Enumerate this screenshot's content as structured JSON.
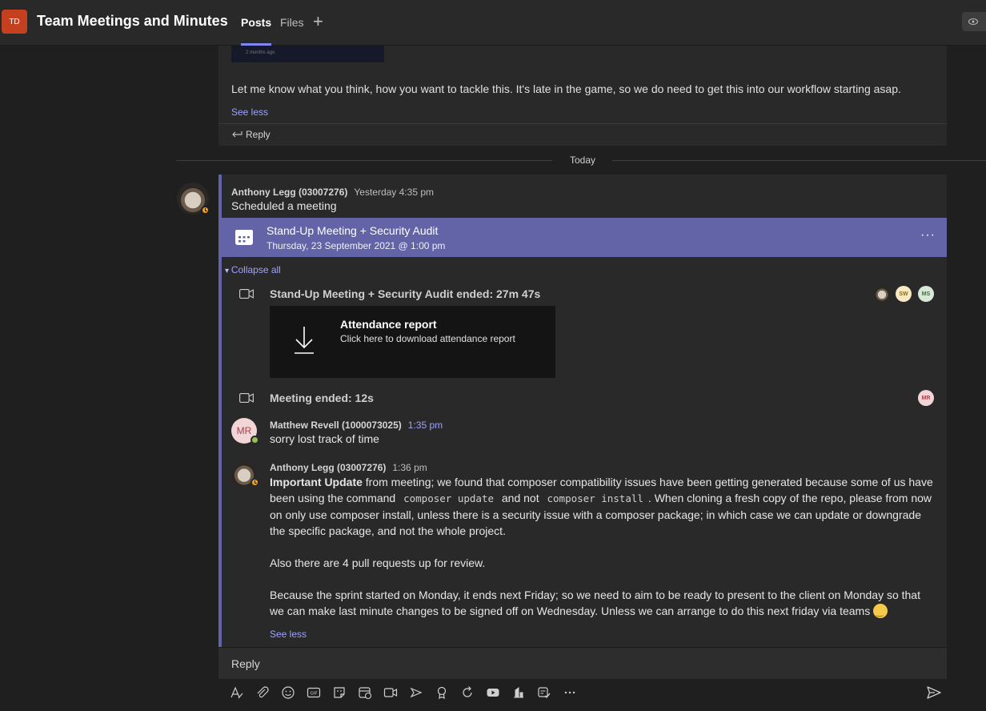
{
  "header": {
    "team_initials": "TD",
    "title": "Team Meetings and Minutes",
    "tabs": [
      {
        "label": "Posts",
        "active": true
      },
      {
        "label": "Files",
        "active": false
      }
    ],
    "add_tab": "+"
  },
  "previous_post": {
    "thumbnail_text_a": "2 months ago",
    "text": "Let me know what you think, how you want to tackle this. It's late in the game, so we do need to get this into our workflow starting asap.",
    "see_less": "See less",
    "reply": "Reply"
  },
  "divider": {
    "label": "Today"
  },
  "thread": {
    "root": {
      "author": "Anthony Legg (03007276)",
      "time": "Yesterday 4:35 pm",
      "text": "Scheduled a meeting"
    },
    "meeting": {
      "title": "Stand-Up Meeting + Security Audit",
      "subtitle": "Thursday, 23 September 2021 @ 1:00 pm",
      "more": "···"
    },
    "collapse_all": "Collapse all",
    "events": [
      {
        "text": "Stand-Up Meeting + Security Audit ended: 27m 47s",
        "participants": [
          "SW",
          "MS"
        ]
      },
      {
        "text": "Meeting ended: 12s",
        "participants": [
          "MR"
        ]
      }
    ],
    "attendance": {
      "title": "Attendance report",
      "subtitle": "Click here to download attendance report"
    },
    "reply_1": {
      "initials": "MR",
      "author": "Matthew Revell (1000073025)",
      "time": "1:35 pm",
      "text": "sorry lost track of time"
    },
    "reply_2": {
      "author": "Anthony Legg (03007276)",
      "time": "1:36 pm",
      "bold_lead": "Important Update",
      "p1_a": " from meeting; we found that composer compatibility issues have been getting generated because some of us have been using the command ",
      "code_1": "composer update",
      "p1_b": " and not ",
      "code_2": "composer install",
      "p1_c": ". When cloning a fresh copy of the repo, please from now on only use composer install, unless there is a security issue with a composer package; in which case we can update or downgrade the specific package, and not the whole project.",
      "p2": "Also there are 4 pull requests up for review.",
      "p3": "Because the sprint started on Monday, it ends next Friday; so we need to aim to be ready to present to the client on Monday so that we can make last minute changes to be signed off on Wednesday. Unless we can arrange to do this next friday via teams ",
      "see_less": "See less"
    }
  },
  "reply_box": {
    "placeholder": "Reply"
  },
  "toolbar": {
    "icons": [
      "format-icon",
      "attach-icon",
      "emoji-icon",
      "gif-icon",
      "sticker-icon",
      "schedule-meeting-icon",
      "video-clip-icon",
      "stream-icon",
      "praise-icon",
      "loop-icon",
      "youtube-icon",
      "analytics-icon",
      "approvals-icon",
      "more-icon",
      "send-icon"
    ]
  },
  "colors": {
    "accent": "#6264a7",
    "link": "#9ea2ff",
    "team_avatar": "#c4401f",
    "away": "#f8a51c",
    "available": "#92c353"
  }
}
